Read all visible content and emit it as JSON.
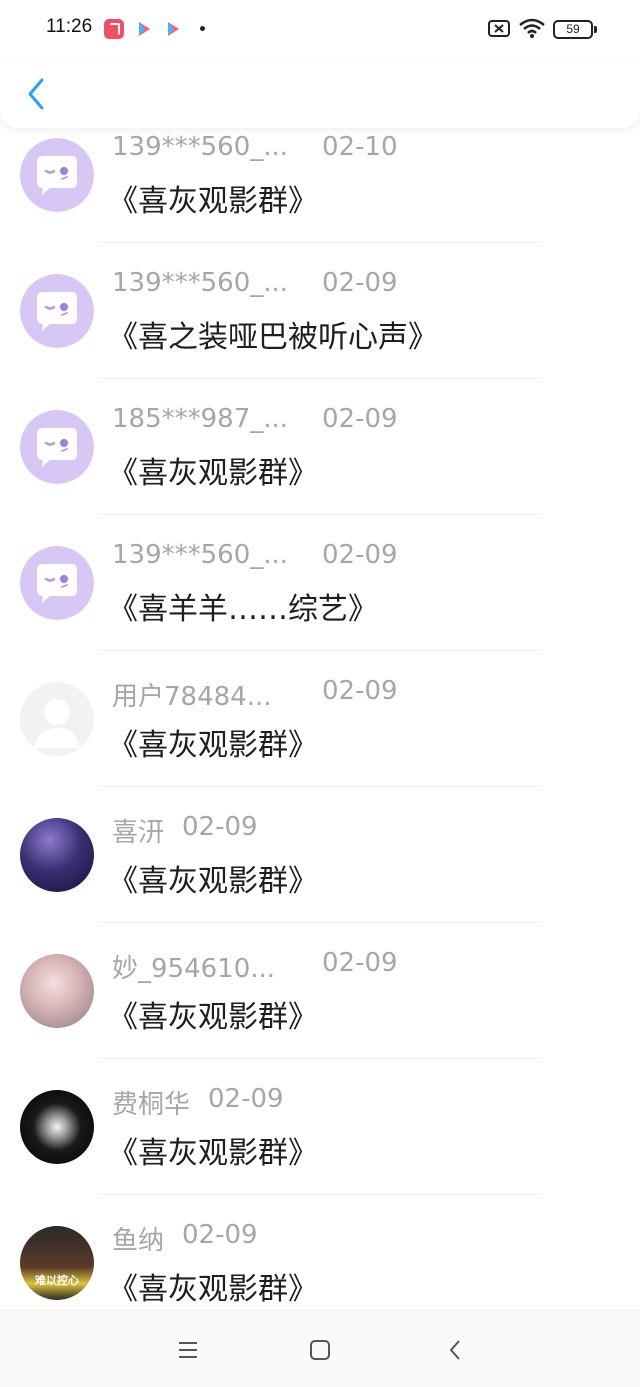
{
  "status_bar": {
    "time": "11:26",
    "battery": "59",
    "icons": [
      "tiktok-icon",
      "play-icon",
      "play-icon",
      "sim-error-icon",
      "wifi-icon",
      "battery-icon"
    ]
  },
  "header": {
    "back_icon": "chevron-left-icon",
    "accent_color": "#2b9ff0"
  },
  "messages": [
    {
      "name": "139***560_...",
      "date": "02-10",
      "title": "《喜灰观影群》",
      "avatar": "chat-bubble-avatar"
    },
    {
      "name": "139***560_...",
      "date": "02-09",
      "title": "《喜之装哑巴被听心声》",
      "avatar": "chat-bubble-avatar"
    },
    {
      "name": "185***987_...",
      "date": "02-09",
      "title": "《喜灰观影群》",
      "avatar": "chat-bubble-avatar"
    },
    {
      "name": "139***560_...",
      "date": "02-09",
      "title": "《喜羊羊……综艺》",
      "avatar": "chat-bubble-avatar"
    },
    {
      "name": "用户78484...",
      "date": "02-09",
      "title": "《喜灰观影群》",
      "avatar": "default-user-avatar"
    },
    {
      "name": "喜汧",
      "date": "02-09",
      "title": "《喜灰观影群》",
      "avatar": "photo-avatar"
    },
    {
      "name": "妙_954610...",
      "date": "02-09",
      "title": "《喜灰观影群》",
      "avatar": "photo-avatar"
    },
    {
      "name": "费桐华",
      "date": "02-09",
      "title": "《喜灰观影群》",
      "avatar": "photo-avatar"
    },
    {
      "name": "鱼纳",
      "date": "02-09",
      "title": "《喜灰观影群》",
      "avatar": "photo-avatar",
      "avatar_caption": "难以控心"
    }
  ],
  "nav_bar": {
    "icons": [
      "menu-icon",
      "home-square-icon",
      "back-triangle-icon"
    ]
  },
  "colors": {
    "purple_avatar": "#d8c6f5",
    "meta_text": "#a6a6a6",
    "title_text": "#1e1e1e"
  }
}
